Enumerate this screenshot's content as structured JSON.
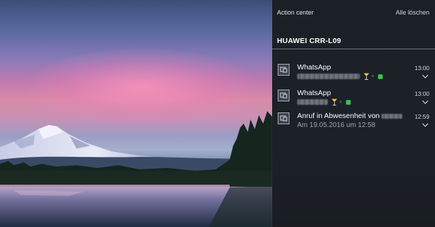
{
  "action_center": {
    "title": "Action center",
    "clear_all_label": "Alle löschen",
    "group": {
      "device_name": "HUAWEI CRR-L09",
      "notifications": [
        {
          "app": "WhatsApp",
          "time": "13:00",
          "body_suffix": "▫",
          "icon": "app-tile-icon",
          "emojis": [
            "cocktail-emoji",
            "clover-emoji"
          ]
        },
        {
          "app": "WhatsApp",
          "time": "13:00",
          "body_suffix": "▫",
          "icon": "app-tile-icon",
          "emojis": [
            "cocktail-emoji",
            "clover-emoji"
          ]
        },
        {
          "title_prefix": "Anruf in Abwesenheit von",
          "time": "12:59",
          "body": "Am 19.05.2016 um 12:58",
          "icon": "app-tile-icon"
        }
      ]
    }
  },
  "colors": {
    "panel_bg": "#1b1f26",
    "secondary_text": "#9fa3a9",
    "divider": "#6d7179"
  }
}
